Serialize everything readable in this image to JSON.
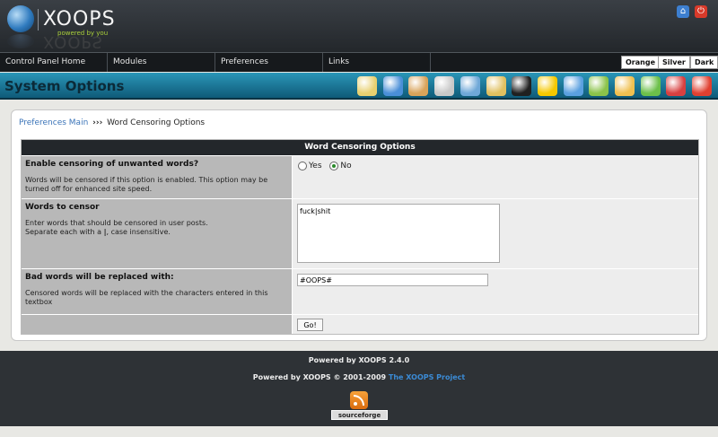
{
  "header": {
    "logo_text": "XOOPS",
    "logo_tagline": "powered by you",
    "home_icon": "home-icon",
    "logout_icon": "power-icon"
  },
  "nav": {
    "items": [
      {
        "label": "Control Panel Home"
      },
      {
        "label": "Modules"
      },
      {
        "label": "Preferences"
      },
      {
        "label": "Links"
      }
    ],
    "themes": [
      "Orange",
      "Silver",
      "Dark"
    ]
  },
  "titlebar": {
    "title": "System Options",
    "tools": [
      {
        "icon": "notepad-icon",
        "color": "#e8d070"
      },
      {
        "icon": "globe-icon",
        "color": "#4a8fd8"
      },
      {
        "icon": "users-icon",
        "color": "#d9a35a"
      },
      {
        "icon": "house-icon",
        "color": "#c8c8c8"
      },
      {
        "icon": "magnifier-icon",
        "color": "#6fa8d8"
      },
      {
        "icon": "person-icon",
        "color": "#e0c060"
      },
      {
        "icon": "star-icon",
        "color": "#202020"
      },
      {
        "icon": "smiley-icon",
        "color": "#f5c800"
      },
      {
        "icon": "monitor-icon",
        "color": "#5aa0e0"
      },
      {
        "icon": "package-icon",
        "color": "#8bc34a"
      },
      {
        "icon": "mail-icon",
        "color": "#f0c050"
      },
      {
        "icon": "group-icon",
        "color": "#6cc04a"
      },
      {
        "icon": "blocks-icon",
        "color": "#d84040"
      },
      {
        "icon": "screen-icon",
        "color": "#e04030"
      }
    ]
  },
  "breadcrumb": {
    "link": "Preferences Main",
    "separator": "›››",
    "current": "Word Censoring Options"
  },
  "form": {
    "heading": "Word Censoring Options",
    "rows": [
      {
        "title": "Enable censoring of unwanted words?",
        "desc": "Words will be censored if this option is enabled. This option may be turned off for enhanced site speed.",
        "yes_label": "Yes",
        "no_label": "No",
        "selected": "No"
      },
      {
        "title": "Words to censor",
        "desc_line1": "Enter words that should be censored in user posts.",
        "desc_line2_pre": "Separate each with a ",
        "desc_line2_sym": "|",
        "desc_line2_post": ", case insensitive.",
        "value": "fuck|shit"
      },
      {
        "title": "Bad words will be replaced with:",
        "desc": "Censored words will be replaced with the characters entered in this textbox",
        "value": "#OOPS#"
      }
    ],
    "submit_label": "Go!"
  },
  "footer": {
    "powered_line": "Powered by XOOPS 2.4.0",
    "copyright_pre": "Powered by XOOPS © 2001-2009 ",
    "copyright_link": "The XOOPS Project",
    "rss_icon": "rss-icon",
    "badge": "sourceforge"
  }
}
